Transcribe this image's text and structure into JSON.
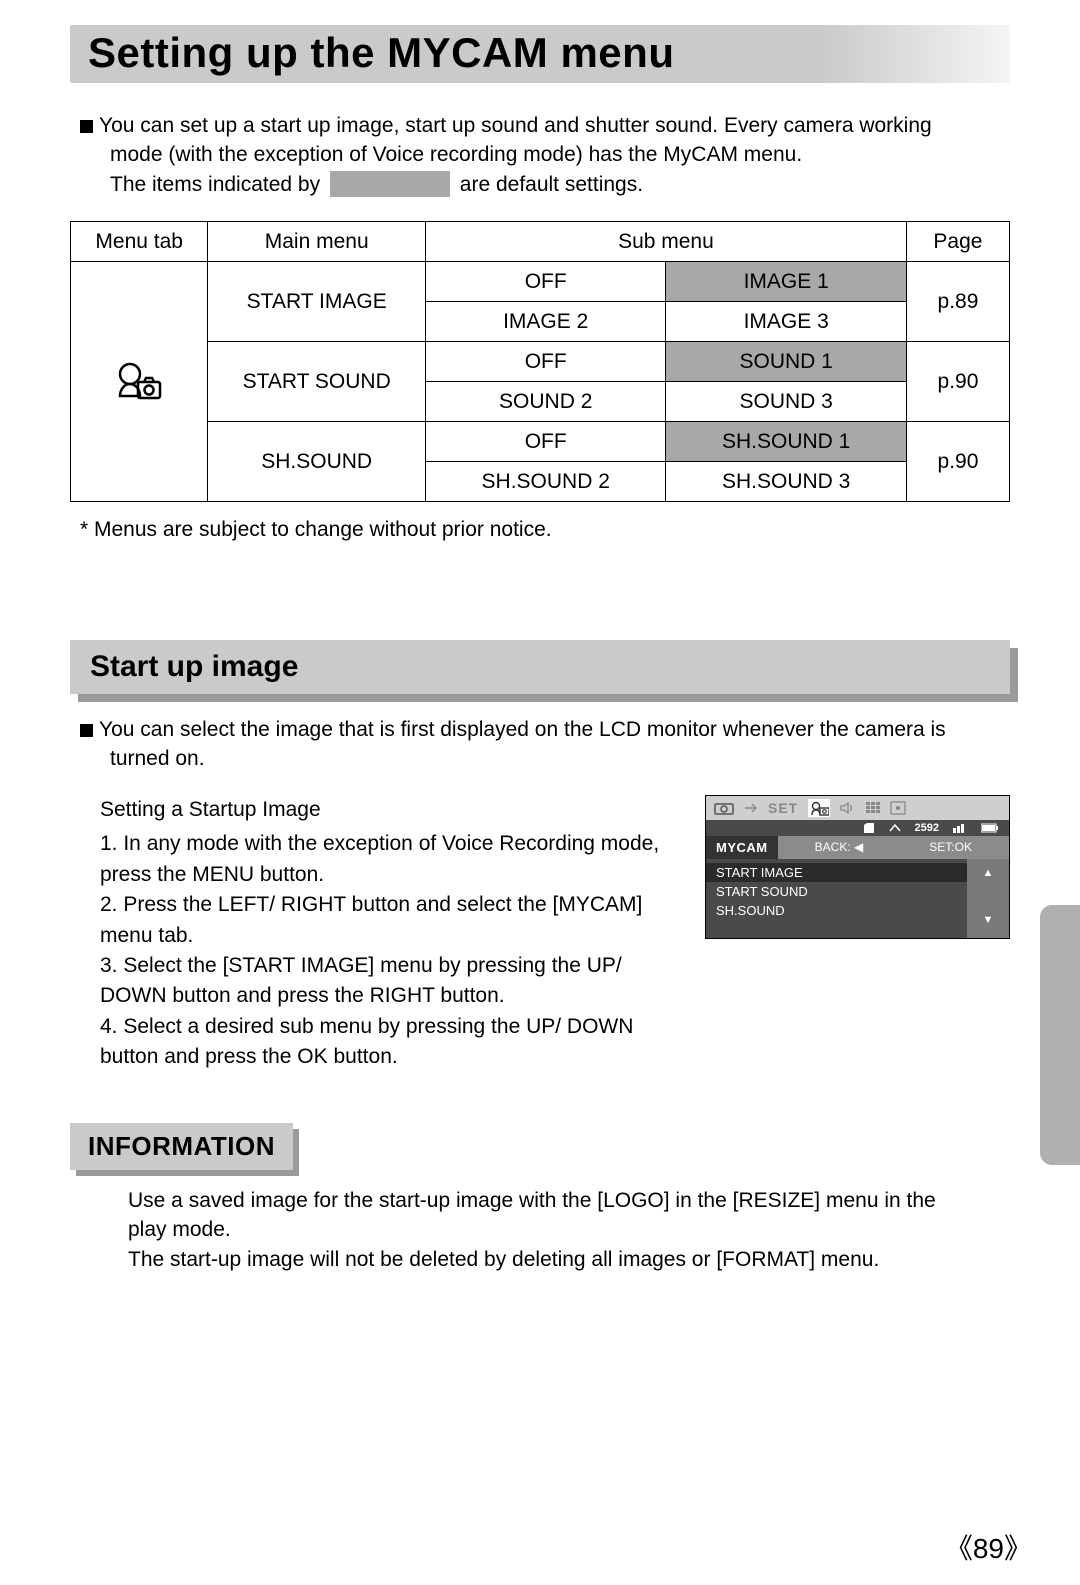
{
  "title": "Setting up the MYCAM menu",
  "intro": {
    "line1": "You can set up a start up image, start up sound and shutter sound. Every camera working",
    "line2": "mode (with the exception of Voice recording mode) has the MyCAM menu.",
    "line3a": "The items indicated by ",
    "line3b": " are default settings."
  },
  "table": {
    "headers": {
      "tab": "Menu tab",
      "main": "Main menu",
      "sub": "Sub menu",
      "page": "Page"
    },
    "rows": [
      {
        "main": "START IMAGE",
        "a": "OFF",
        "b": "IMAGE 1",
        "c": "IMAGE 2",
        "d": "IMAGE 3",
        "page": "p.89",
        "default": "b"
      },
      {
        "main": "START SOUND",
        "a": "OFF",
        "b": "SOUND 1",
        "c": "SOUND 2",
        "d": "SOUND 3",
        "page": "p.90",
        "default": "b"
      },
      {
        "main": "SH.SOUND",
        "a": "OFF",
        "b": "SH.SOUND 1",
        "c": "SH.SOUND 2",
        "d": "SH.SOUND 3",
        "page": "p.90",
        "default": "b"
      }
    ]
  },
  "footnote": "* Menus are subject to change without prior notice.",
  "section2": {
    "heading": "Start up image",
    "desc1": "You can select the image that is first displayed on the LCD monitor whenever the camera is",
    "desc2": "turned on.",
    "sub": "Setting a Startup Image",
    "steps": [
      "1. In any mode with the exception of Voice Recording mode, press the MENU button.",
      "2. Press the LEFT/ RIGHT button and select the [MYCAM] menu tab.",
      "3. Select the [START IMAGE] menu by pressing the UP/ DOWN button and press the RIGHT button.",
      "4. Select a desired sub menu by pressing the UP/ DOWN button and press the OK button."
    ]
  },
  "lcd": {
    "set_label": "SET",
    "res": "2592",
    "tab": "MYCAM",
    "back": "BACK:",
    "ok": "SET:OK",
    "items": [
      "START IMAGE",
      "START SOUND",
      "SH.SOUND"
    ],
    "up": "▲",
    "down": "▼"
  },
  "info": {
    "heading": "INFORMATION",
    "line1": "Use a saved image for the start-up image with the [LOGO] in the [RESIZE] menu in the",
    "line2": "play mode.",
    "line3": "The start-up image will not be deleted by deleting all images or [FORMAT] menu."
  },
  "page_number": "89"
}
